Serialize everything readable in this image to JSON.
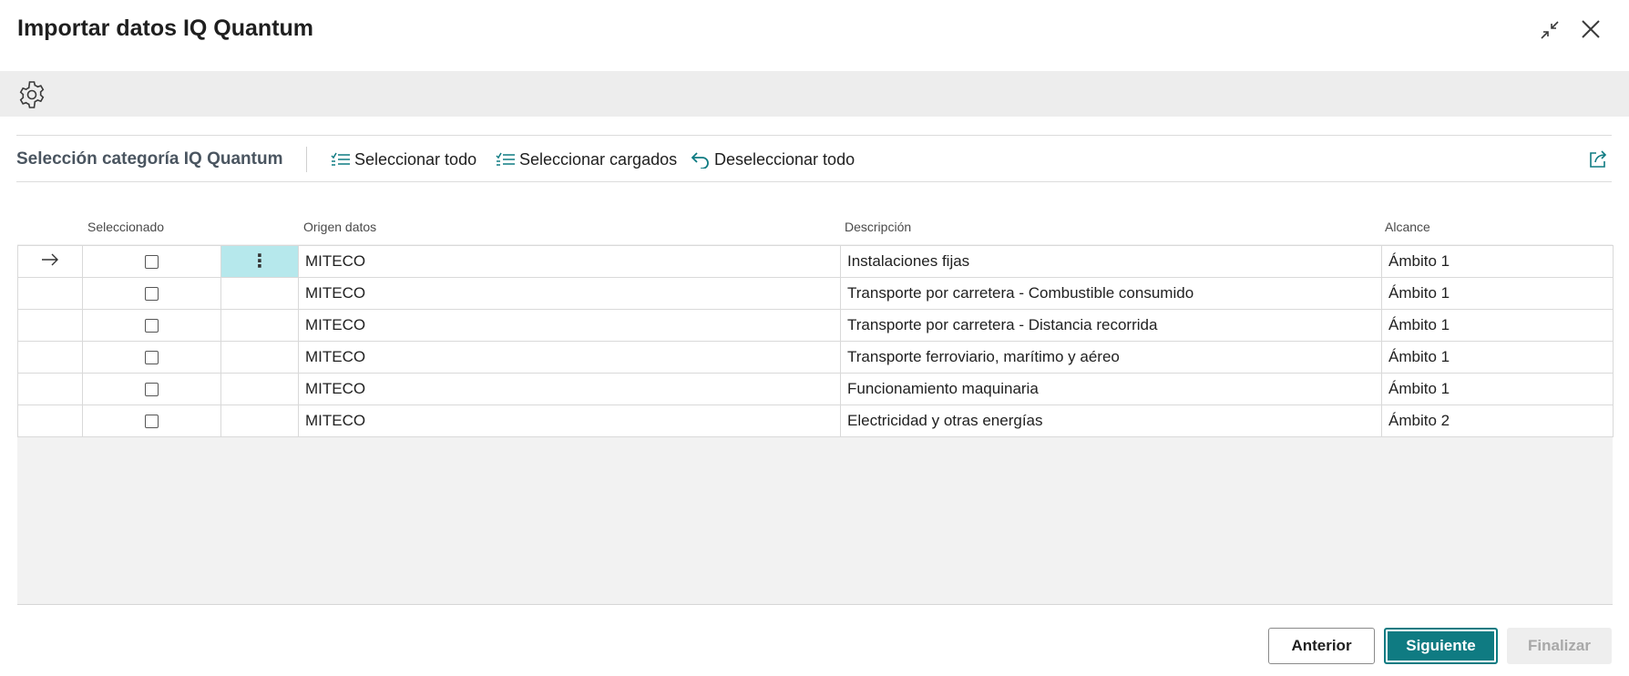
{
  "window": {
    "title": "Importar datos IQ Quantum",
    "collapse_icon": "collapse-icon",
    "close_icon": "close-icon"
  },
  "settings": {
    "icon": "gear-icon"
  },
  "part": {
    "title": "Selección categoría IQ Quantum",
    "actions": [
      {
        "label": "Seleccionar todo",
        "icon": "select-list-icon"
      },
      {
        "label": "Seleccionar cargados",
        "icon": "select-list-icon"
      },
      {
        "label": "Deseleccionar todo",
        "icon": "undo-icon"
      }
    ],
    "share_icon": "share-icon"
  },
  "grid": {
    "columns": [
      "Seleccionado",
      "Origen datos",
      "Descripción",
      "Alcance"
    ],
    "rows": [
      {
        "selected": false,
        "origin": "MITECO",
        "description": "Instalaciones fijas",
        "scope": "Ámbito 1",
        "current": true
      },
      {
        "selected": false,
        "origin": "MITECO",
        "description": "Transporte por carretera - Combustible consumido",
        "scope": "Ámbito 1",
        "current": false
      },
      {
        "selected": false,
        "origin": "MITECO",
        "description": "Transporte por carretera - Distancia recorrida",
        "scope": "Ámbito 1",
        "current": false
      },
      {
        "selected": false,
        "origin": "MITECO",
        "description": "Transporte ferroviario, marítimo y aéreo",
        "scope": "Ámbito 1",
        "current": false
      },
      {
        "selected": false,
        "origin": "MITECO",
        "description": "Funcionamiento maquinaria",
        "scope": "Ámbito 1",
        "current": false
      },
      {
        "selected": false,
        "origin": "MITECO",
        "description": "Electricidad y otras energías",
        "scope": "Ámbito 2",
        "current": false
      }
    ]
  },
  "footer": {
    "prev_label": "Anterior",
    "next_label": "Siguiente",
    "finish_label": "Finalizar"
  },
  "colors": {
    "accent": "#0f7b82",
    "active_cell": "#b6e8ec",
    "toolbar_bg": "#ededed"
  }
}
